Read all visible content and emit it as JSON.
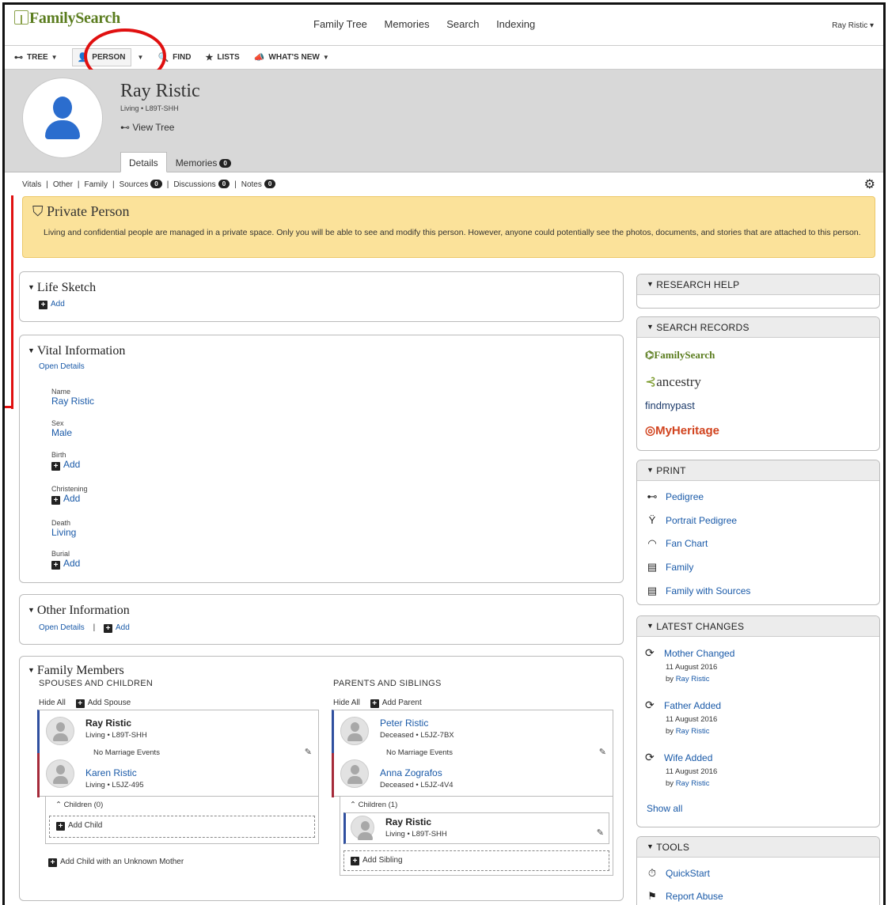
{
  "header": {
    "logo": "FamilySearch",
    "nav": [
      "Family Tree",
      "Memories",
      "Search",
      "Indexing"
    ],
    "user": "Ray Ristic ▾"
  },
  "subnav": {
    "tree": "TREE",
    "person": "PERSON",
    "find": "FIND",
    "lists": "LISTS",
    "whats_new": "WHAT'S NEW"
  },
  "person": {
    "name": "Ray Ristic",
    "meta": "Living • L89T-SHH",
    "view_tree": "View Tree",
    "tab_details": "Details",
    "tab_memories": "Memories",
    "memories_count": "0"
  },
  "sections": {
    "vitals": "Vitals",
    "other": "Other",
    "family": "Family",
    "sources": "Sources",
    "sources_count": "0",
    "discussions": "Discussions",
    "discussions_count": "0",
    "notes": "Notes",
    "notes_count": "0"
  },
  "private": {
    "title": "Private Person",
    "text": "Living and confidential people are managed in a private space. Only you will be able to see and modify this person. However, anyone could potentially see the photos, documents, and stories that are attached to this person."
  },
  "life_sketch": {
    "title": "Life Sketch",
    "add": "Add"
  },
  "vital": {
    "title": "Vital Information",
    "open_details": "Open Details",
    "fields": [
      {
        "label": "Name",
        "value": "Ray Ristic"
      },
      {
        "label": "Sex",
        "value": "Male"
      },
      {
        "label": "Birth",
        "value": "Add"
      },
      {
        "label": "Christening",
        "value": "Add"
      },
      {
        "label": "Death",
        "value": "Living"
      },
      {
        "label": "Burial",
        "value": "Add"
      }
    ]
  },
  "other_info": {
    "title": "Other Information",
    "open_details": "Open Details",
    "add": "Add"
  },
  "family": {
    "title": "Family Members",
    "spouses_title": "SPOUSES AND CHILDREN",
    "parents_title": "PARENTS AND SIBLINGS",
    "hide_all": "Hide All",
    "add_spouse": "Add Spouse",
    "add_parent": "Add Parent",
    "no_marriage": "No Marriage Events",
    "spouse1": {
      "name": "Ray Ristic",
      "meta": "Living • L89T-SHH"
    },
    "spouse2": {
      "name": "Karen Ristic",
      "meta": "Living • L5JZ-495"
    },
    "children0": "Children (0)",
    "add_child": "Add Child",
    "add_child_unknown": "Add Child with an Unknown Mother",
    "parent1": {
      "name": "Peter Ristic",
      "meta": "Deceased • L5JZ-7BX"
    },
    "parent2": {
      "name": "Anna Zografos",
      "meta": "Deceased • L5JZ-4V4"
    },
    "children1": "Children (1)",
    "child1": {
      "name": "Ray Ristic",
      "meta": "Living • L89T-SHH"
    },
    "add_sibling": "Add Sibling"
  },
  "right": {
    "research_help": "RESEARCH HELP",
    "search_records": "SEARCH RECORDS",
    "providers": [
      "FamilySearch",
      "ancestry",
      "findmypast",
      "MyHeritage"
    ],
    "print": "PRINT",
    "print_items": [
      "Pedigree",
      "Portrait Pedigree",
      "Fan Chart",
      "Family",
      "Family with Sources"
    ],
    "latest_changes": "LATEST CHANGES",
    "changes": [
      {
        "title": "Mother Changed",
        "date": "11 August 2016",
        "by": "by",
        "user": "Ray Ristic"
      },
      {
        "title": "Father Added",
        "date": "11 August 2016",
        "by": "by",
        "user": "Ray Ristic"
      },
      {
        "title": "Wife Added",
        "date": "11 August 2016",
        "by": "by",
        "user": "Ray Ristic"
      }
    ],
    "show_all": "Show all",
    "tools": "TOOLS",
    "tool_items": [
      "QuickStart",
      "Report Abuse"
    ]
  }
}
